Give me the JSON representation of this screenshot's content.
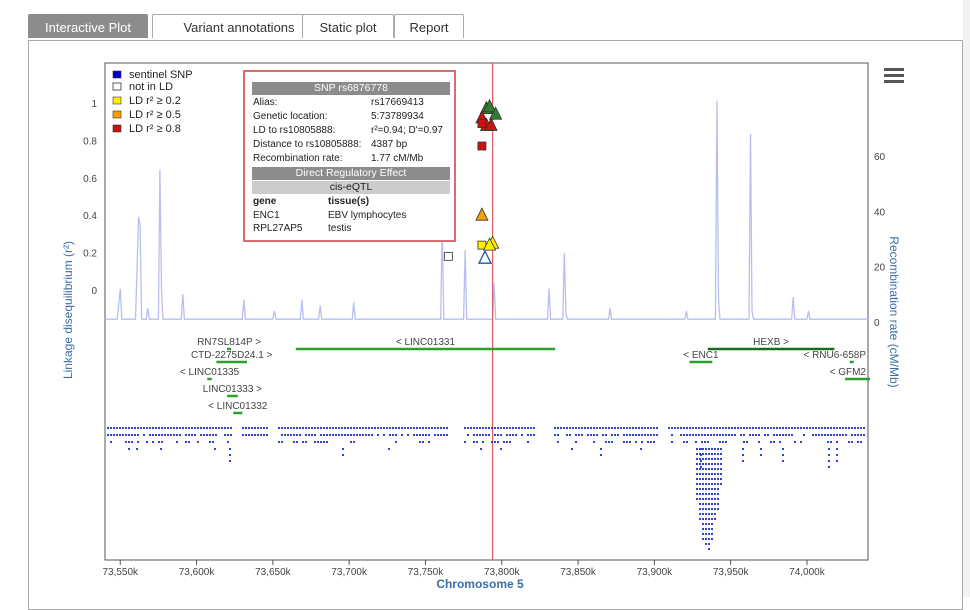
{
  "tabs": [
    {
      "label": "Interactive Plot",
      "active": true
    },
    {
      "label": "Variant annotations",
      "active": false
    },
    {
      "label": "Static plot",
      "active": false
    },
    {
      "label": "Report",
      "active": false
    }
  ],
  "legend": [
    {
      "label": "sentinel SNP",
      "color": "#0000cc"
    },
    {
      "label": "not in LD",
      "color": "#ffffff"
    },
    {
      "label": "LD r² ≥ 0.2",
      "color": "#ffee00"
    },
    {
      "label": "LD r² ≥ 0.5",
      "color": "#f5a000"
    },
    {
      "label": "LD r² ≥ 0.8",
      "color": "#cc1111"
    }
  ],
  "popup": {
    "title": "SNP rs6876778",
    "rows": [
      {
        "k": "Alias:",
        "v": "rs17669413"
      },
      {
        "k": "Genetic location:",
        "v": "5:73789934"
      },
      {
        "k": "LD to rs10805888:",
        "v": "r²=0.94; D'=0.97"
      },
      {
        "k": "Distance to rs10805888:",
        "v": "4387 bp"
      },
      {
        "k": "Recombination rate:",
        "v": "1.77 cM/Mb"
      }
    ],
    "section": "Direct Regulatory Effect",
    "subsection": "cis-eQTL",
    "col_gene": "gene",
    "col_tissue": "tissue(s)",
    "eqtl": [
      {
        "gene": "ENC1",
        "tissue": "EBV lymphocytes"
      },
      {
        "gene": "RPL27AP5",
        "tissue": "testis"
      }
    ]
  },
  "chart_data": {
    "type": "scatter",
    "xlabel": "Chromosome 5",
    "ylabel": "Linkage disequilibrium (r²)",
    "y2label": "Recombination rate (cM/Mb)",
    "xlim": [
      73540000,
      74040000
    ],
    "ylim": [
      -0.15,
      1.05
    ],
    "y2lim": [
      0,
      80
    ],
    "x_ticks": [
      73550000,
      73600000,
      73650000,
      73700000,
      73750000,
      73800000,
      73850000,
      73900000,
      73950000,
      74000000
    ],
    "x_tick_labels": [
      "73,550k",
      "73,600k",
      "73,650k",
      "73,700k",
      "73,750k",
      "73,800k",
      "73,850k",
      "73,900k",
      "73,950k",
      "74,000k"
    ],
    "y_ticks": [
      0,
      0.2,
      0.4,
      0.6,
      0.8,
      1
    ],
    "y_tick_labels": [
      "0",
      "0.2",
      "0.4",
      "0.6",
      "0.8",
      "1"
    ],
    "y2_ticks": [
      0,
      20,
      40,
      60
    ],
    "y2_tick_labels": [
      "0",
      "20",
      "40",
      "60"
    ],
    "sentinel_x": 73794000,
    "points": [
      {
        "x": 73789934,
        "r2": 0.97,
        "shape": "triangle",
        "color": "#2e7d32"
      },
      {
        "x": 73792000,
        "r2": 0.98,
        "shape": "triangle",
        "color": "#2e7d32"
      },
      {
        "x": 73796000,
        "r2": 0.94,
        "shape": "triangle",
        "color": "#2e7d32"
      },
      {
        "x": 73787000,
        "r2": 0.92,
        "shape": "triangle",
        "color": "#cc1111"
      },
      {
        "x": 73790000,
        "r2": 0.88,
        "shape": "triangle",
        "color": "#cc1111"
      },
      {
        "x": 73793000,
        "r2": 0.88,
        "shape": "triangle",
        "color": "#cc1111"
      },
      {
        "x": 73787000,
        "r2": 0.89,
        "shape": "square",
        "color": "#cc1111"
      },
      {
        "x": 73787000,
        "r2": 0.77,
        "shape": "square",
        "color": "#cc1111"
      },
      {
        "x": 73787000,
        "r2": 0.4,
        "shape": "triangle",
        "color": "#f5a000"
      },
      {
        "x": 73787000,
        "r2": 0.24,
        "shape": "square",
        "color": "#ffee00"
      },
      {
        "x": 73794000,
        "r2": 0.25,
        "shape": "triangle",
        "color": "#ffee00"
      },
      {
        "x": 73792000,
        "r2": 0.24,
        "shape": "triangle",
        "color": "#ffee00"
      },
      {
        "x": 73765000,
        "r2": 0.18,
        "shape": "square",
        "color": "#ffffff"
      },
      {
        "x": 73789000,
        "r2": 0.17,
        "shape": "triangle",
        "color": "#ffffff"
      }
    ],
    "recombination": [
      [
        73540000,
        1
      ],
      [
        73548000,
        1
      ],
      [
        73550000,
        12
      ],
      [
        73551000,
        1
      ],
      [
        73560000,
        1
      ],
      [
        73562000,
        38
      ],
      [
        73563000,
        35
      ],
      [
        73564000,
        1
      ],
      [
        73567000,
        1
      ],
      [
        73568000,
        5
      ],
      [
        73569000,
        1
      ],
      [
        73575000,
        1
      ],
      [
        73576000,
        55
      ],
      [
        73577000,
        12
      ],
      [
        73578000,
        1
      ],
      [
        73590000,
        1
      ],
      [
        73591000,
        10
      ],
      [
        73592000,
        1
      ],
      [
        73630000,
        1
      ],
      [
        73631000,
        8
      ],
      [
        73632000,
        1
      ],
      [
        73650000,
        1
      ],
      [
        73651000,
        4
      ],
      [
        73652000,
        1
      ],
      [
        73668000,
        1
      ],
      [
        73669000,
        8
      ],
      [
        73670000,
        1
      ],
      [
        73680000,
        1
      ],
      [
        73681000,
        6
      ],
      [
        73682000,
        1
      ],
      [
        73702000,
        1
      ],
      [
        73703000,
        7
      ],
      [
        73704000,
        1
      ],
      [
        73760000,
        1
      ],
      [
        73761000,
        35
      ],
      [
        73762000,
        1
      ],
      [
        73775000,
        1
      ],
      [
        73776000,
        26
      ],
      [
        73777000,
        1
      ],
      [
        73794000,
        1
      ],
      [
        73795000,
        14
      ],
      [
        73796000,
        1
      ],
      [
        73830000,
        1
      ],
      [
        73831000,
        12
      ],
      [
        73832000,
        1
      ],
      [
        73840000,
        1
      ],
      [
        73841000,
        25
      ],
      [
        73842000,
        3
      ],
      [
        73843000,
        1
      ],
      [
        73870000,
        1
      ],
      [
        73871000,
        5
      ],
      [
        73872000,
        1
      ],
      [
        73920000,
        1
      ],
      [
        73921000,
        4
      ],
      [
        73922000,
        1
      ],
      [
        73940000,
        1
      ],
      [
        73941000,
        80
      ],
      [
        73942000,
        8
      ],
      [
        73943000,
        1
      ],
      [
        73962000,
        1
      ],
      [
        73963000,
        68
      ],
      [
        73964000,
        4
      ],
      [
        73965000,
        1
      ],
      [
        73990000,
        1
      ],
      [
        73991000,
        9
      ],
      [
        73992000,
        1
      ],
      [
        74000000,
        1
      ],
      [
        74001000,
        4
      ],
      [
        74002000,
        1
      ],
      [
        74040000,
        1
      ]
    ]
  },
  "genes": [
    {
      "label": "RN7SL814P >",
      "start": 73620000,
      "end": 73620000,
      "row": 0,
      "color": "#2ca02c"
    },
    {
      "label": "< LINC01331",
      "start": 73665000,
      "end": 73835000,
      "row": 0,
      "color": "#2ca02c"
    },
    {
      "label": "HEXB >",
      "start": 73935000,
      "end": 74018000,
      "row": 0,
      "color": "#1a6b1a"
    },
    {
      "label": "CTD-2275D24.1 >",
      "start": 73613000,
      "end": 73633000,
      "row": 1,
      "color": "#2ca02c"
    },
    {
      "label": "< ENC1",
      "start": 73923000,
      "end": 73938000,
      "row": 1,
      "color": "#2ca02c"
    },
    {
      "label": "< RNU6-658P",
      "start": 74028000,
      "end": 74028000,
      "row": 1,
      "color": "#2ca02c"
    },
    {
      "label": "< LINC01335",
      "start": 73607000,
      "end": 73610000,
      "row": 2,
      "color": "#2ca02c"
    },
    {
      "label": "< GFM2",
      "start": 74025000,
      "end": 74042000,
      "row": 2,
      "color": "#2ca02c"
    },
    {
      "label": "LINC01333 >",
      "start": 73620000,
      "end": 73627000,
      "row": 3,
      "color": "#2ca02c"
    },
    {
      "label": "< LINC01332",
      "start": 73624000,
      "end": 73630000,
      "row": 4,
      "color": "#2ca02c"
    }
  ],
  "colors": {
    "recomb_line": "#b8bff0",
    "sentinel_line": "#d96060",
    "snp_marks": "#3344cc",
    "axis_label": "#3a6ea8"
  }
}
